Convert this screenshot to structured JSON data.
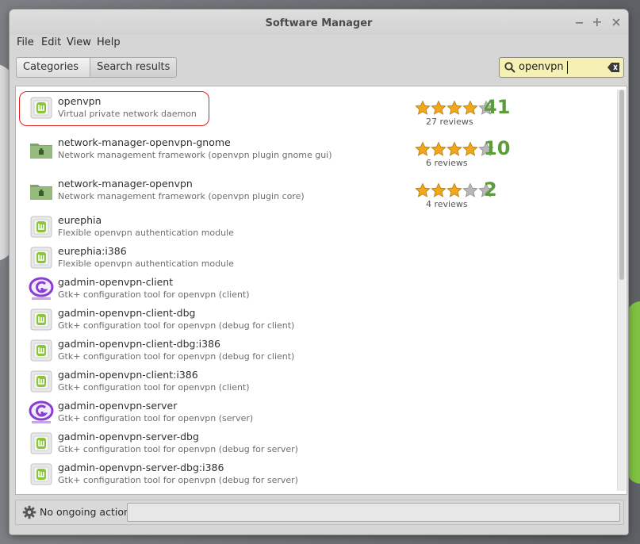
{
  "window": {
    "title": "Software Manager"
  },
  "menubar": {
    "items": [
      "File",
      "Edit",
      "View",
      "Help"
    ]
  },
  "breadcrumb": {
    "items": [
      "Categories",
      "Search results"
    ]
  },
  "search": {
    "value": "openvpn"
  },
  "packages": [
    {
      "name": "openvpn",
      "description": "Virtual private network daemon",
      "icon": "generic-package-icon",
      "rating": 4,
      "score": "41",
      "reviews": "27 reviews"
    },
    {
      "name": "network-manager-openvpn-gnome",
      "description": "Network management framework (openvpn plugin gnome gui)",
      "icon": "folder-package-icon",
      "rating": 4,
      "score": "10",
      "reviews": "6 reviews"
    },
    {
      "name": "network-manager-openvpn",
      "description": "Network management framework (openvpn plugin core)",
      "icon": "folder-package-icon",
      "rating": 3,
      "score": "2",
      "reviews": "4 reviews"
    },
    {
      "name": "eurephia",
      "description": "Flexible openvpn authentication module",
      "icon": "generic-package-icon"
    },
    {
      "name": "eurephia:i386",
      "description": "Flexible openvpn authentication module",
      "icon": "generic-package-icon"
    },
    {
      "name": "gadmin-openvpn-client",
      "description": "Gtk+ configuration tool for openvpn (client)",
      "icon": "gadmin-icon"
    },
    {
      "name": "gadmin-openvpn-client-dbg",
      "description": "Gtk+ configuration tool for openvpn (debug for client)",
      "icon": "generic-package-icon"
    },
    {
      "name": "gadmin-openvpn-client-dbg:i386",
      "description": "Gtk+ configuration tool for openvpn (debug for client)",
      "icon": "generic-package-icon"
    },
    {
      "name": "gadmin-openvpn-client:i386",
      "description": "Gtk+ configuration tool for openvpn (client)",
      "icon": "generic-package-icon"
    },
    {
      "name": "gadmin-openvpn-server",
      "description": "Gtk+ configuration tool for openvpn (server)",
      "icon": "gadmin-icon"
    },
    {
      "name": "gadmin-openvpn-server-dbg",
      "description": "Gtk+ configuration tool for openvpn (debug for server)",
      "icon": "generic-package-icon"
    },
    {
      "name": "gadmin-openvpn-server-dbg:i386",
      "description": "Gtk+ configuration tool for openvpn (debug for server)",
      "icon": "generic-package-icon"
    }
  ],
  "status": {
    "text": "No ongoing actions"
  },
  "colors": {
    "highlight": "#e11d1d",
    "score": "#5d9c3d",
    "search_bg": "#f5f0b4",
    "star_fill": "#f2a81c",
    "star_empty": "#b8b8b8"
  }
}
